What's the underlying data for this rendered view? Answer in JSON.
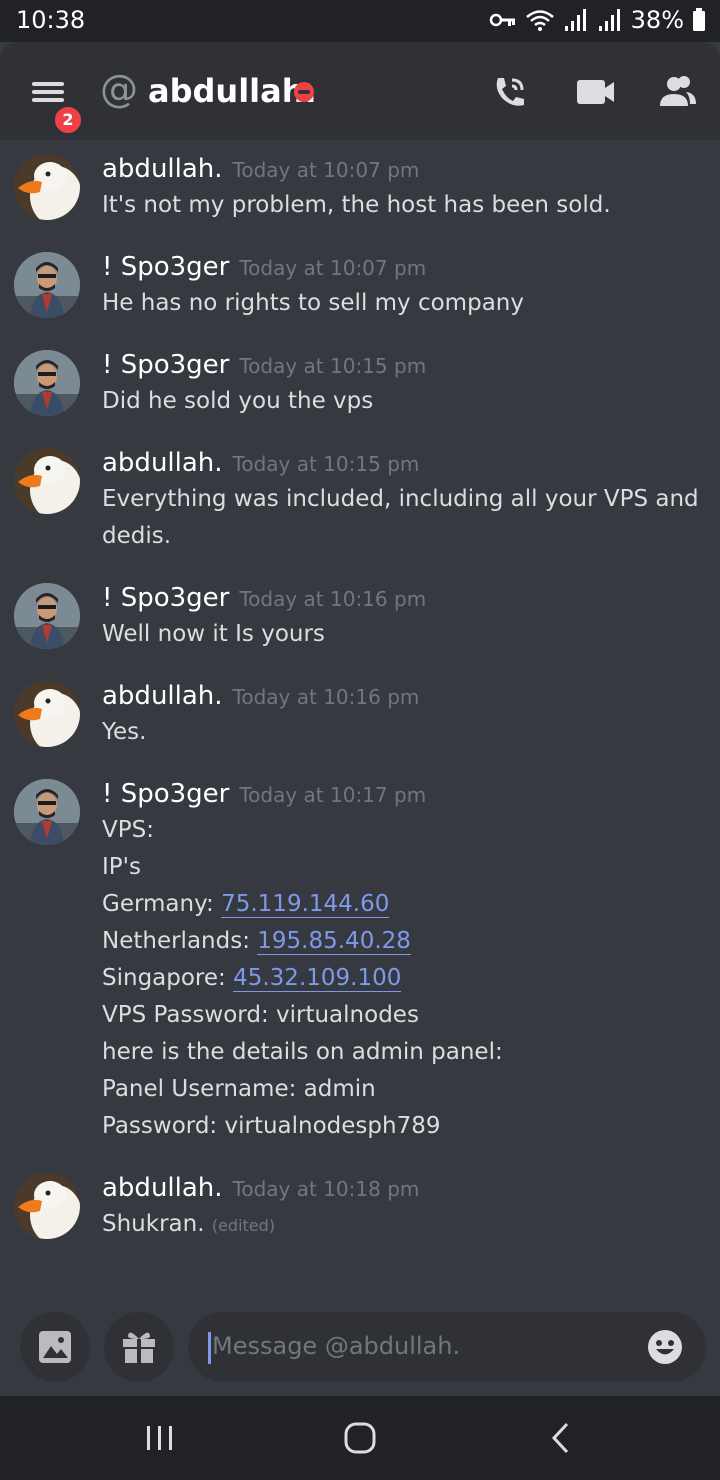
{
  "status_bar": {
    "time": "10:38",
    "battery": "38%"
  },
  "header": {
    "badge_count": "2",
    "at_symbol": "@",
    "title": "abdullah."
  },
  "messages": [
    {
      "author": "abdullah.",
      "time": "Today at 10:07 pm",
      "lines": [
        "It's not my problem, the host has been sold."
      ],
      "avatar": "duck"
    },
    {
      "author": "! Spo3ger",
      "time": "Today at 10:07 pm",
      "lines": [
        "He has no rights to sell my company"
      ],
      "avatar": "person"
    },
    {
      "author": "! Spo3ger",
      "time": "Today at 10:15 pm",
      "lines": [
        "Did he sold you the vps"
      ],
      "avatar": "person"
    },
    {
      "author": "abdullah.",
      "time": "Today at 10:15 pm",
      "lines": [
        "Everything was included, including all your VPS and",
        "dedis."
      ],
      "avatar": "duck"
    },
    {
      "author": "! Spo3ger",
      "time": "Today at 10:16 pm",
      "lines": [
        "Well now it Is yours"
      ],
      "avatar": "person"
    },
    {
      "author": "abdullah.",
      "time": "Today at 10:16 pm",
      "lines": [
        "Yes."
      ],
      "avatar": "duck"
    },
    {
      "author": "! Spo3ger",
      "time": "Today at 10:17 pm",
      "lines": [
        "VPS:",
        "IP's",
        "Germany: ",
        "Netherlands: ",
        "Singapore: ",
        "VPS Password: virtualnodes",
        "here is the details on admin panel:",
        "Panel Username: admin",
        "Password: virtualnodesph789"
      ],
      "links": [
        "75.119.144.60",
        "195.85.40.28",
        "45.32.109.100"
      ],
      "avatar": "person"
    },
    {
      "author": "abdullah.",
      "time": "Today at 10:18 pm",
      "lines": [
        "Shukran. "
      ],
      "edited": "(edited)",
      "avatar": "duck"
    }
  ],
  "composer": {
    "placeholder": "Message @abdullah."
  },
  "icons": {
    "menu": "hamburger-menu-icon",
    "call": "phone-call-icon",
    "video": "video-camera-icon",
    "members": "members-icon",
    "image": "image-icon",
    "gift": "gift-icon",
    "emoji": "emoji-icon"
  },
  "colors": {
    "background": "#36393f",
    "header": "#2f3136",
    "link": "#7e99ea",
    "badge": "#ed4245"
  }
}
